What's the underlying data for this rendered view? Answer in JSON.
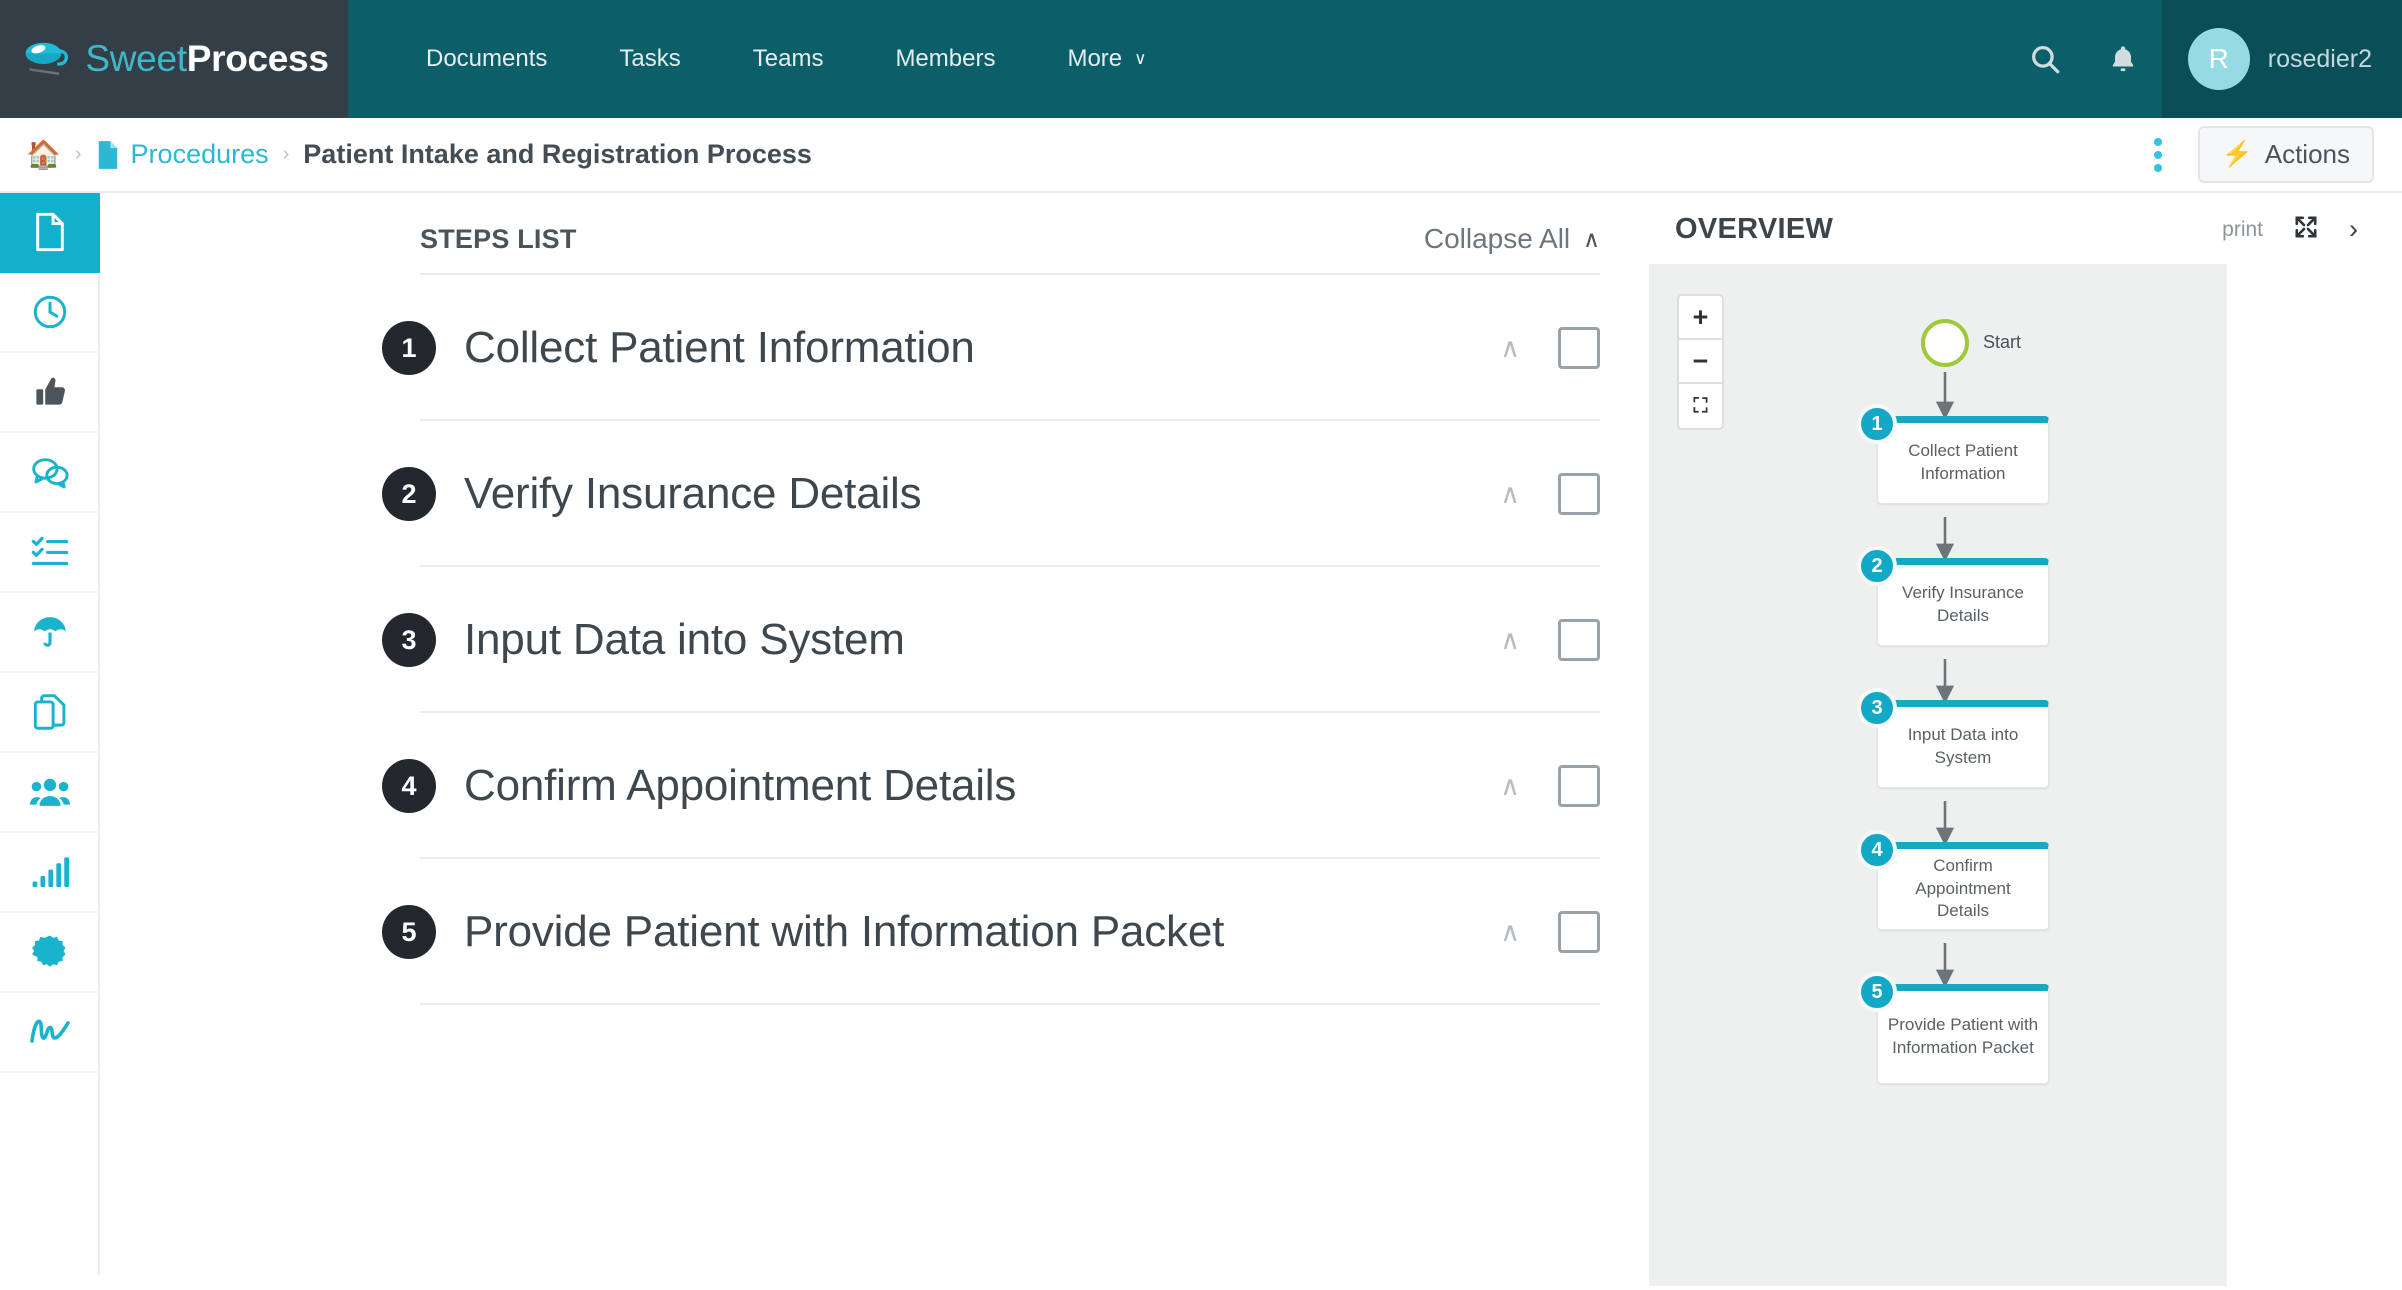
{
  "brand": {
    "sweet": "Sweet",
    "process": "Process",
    "logo_icon": "coffee-cup-logo"
  },
  "topnav": {
    "items": [
      {
        "label": "Documents",
        "name": "documents"
      },
      {
        "label": "Tasks",
        "name": "tasks"
      },
      {
        "label": "Teams",
        "name": "teams"
      },
      {
        "label": "Members",
        "name": "members"
      },
      {
        "label": "More",
        "name": "more",
        "caret": "∨"
      }
    ],
    "search_icon": "search-icon",
    "bell_icon": "notification-bell-icon",
    "user": {
      "initial": "R",
      "name": "rosedier2"
    }
  },
  "breadcrumb": {
    "home_icon": "home-icon",
    "sep": "›",
    "doc_icon": "document-icon",
    "parent": "Procedures",
    "current": "Patient Intake and Registration Process"
  },
  "toolbar": {
    "kebab_icon": "more-options-icon",
    "bolt_icon": "⚡",
    "actions_label": "Actions"
  },
  "sidebar": {
    "items": [
      {
        "name": "document",
        "icon": "document-icon",
        "active": true
      },
      {
        "name": "history",
        "icon": "clock-icon",
        "active": false
      },
      {
        "name": "approvals",
        "icon": "thumbs-up-icon",
        "active": false
      },
      {
        "name": "comments",
        "icon": "comments-icon",
        "active": false
      },
      {
        "name": "tasks",
        "icon": "checklist-icon",
        "active": false
      },
      {
        "name": "policies",
        "icon": "umbrella-icon",
        "active": false
      },
      {
        "name": "duplicate",
        "icon": "copy-icon",
        "active": false
      },
      {
        "name": "teams",
        "icon": "users-icon",
        "active": false
      },
      {
        "name": "reports",
        "icon": "bar-chart-icon",
        "active": false
      },
      {
        "name": "settings",
        "icon": "gear-badge-icon",
        "active": false
      },
      {
        "name": "signature",
        "icon": "signature-icon",
        "active": false
      }
    ]
  },
  "steps_panel": {
    "title": "STEPS LIST",
    "collapse_all": "Collapse All",
    "collapse_chevron": "∧",
    "steps": [
      {
        "num": "1",
        "title": "Collect Patient Information",
        "chevron": "∧"
      },
      {
        "num": "2",
        "title": "Verify Insurance Details",
        "chevron": "∧"
      },
      {
        "num": "3",
        "title": "Input Data into System",
        "chevron": "∧"
      },
      {
        "num": "4",
        "title": "Confirm Appointment Details",
        "chevron": "∧"
      },
      {
        "num": "5",
        "title": "Provide Patient with Information Packet",
        "chevron": "∧"
      }
    ]
  },
  "overview": {
    "title": "OVERVIEW",
    "print": "print",
    "expand_icon": "⤢",
    "next_icon": "›",
    "zoom": {
      "in": "+",
      "out": "−",
      "fit": "⛶"
    },
    "flowchart": {
      "start_label": "Start",
      "nodes": [
        {
          "num": "1",
          "label": "Collect Patient\nInformation"
        },
        {
          "num": "2",
          "label": "Verify Insurance\nDetails"
        },
        {
          "num": "3",
          "label": "Input Data into\nSystem"
        },
        {
          "num": "4",
          "label": "Confirm Appointment\nDetails"
        },
        {
          "num": "5",
          "label": "Provide Patient with\nInformation Packet"
        }
      ]
    }
  },
  "colors": {
    "header_teal": "#0c5f68",
    "brand_dark": "#333e47",
    "accent_cyan": "#12b0cc",
    "node_bar": "#17a9c4",
    "start_green": "#9dc93b",
    "canvas_gray": "#eeefef"
  }
}
